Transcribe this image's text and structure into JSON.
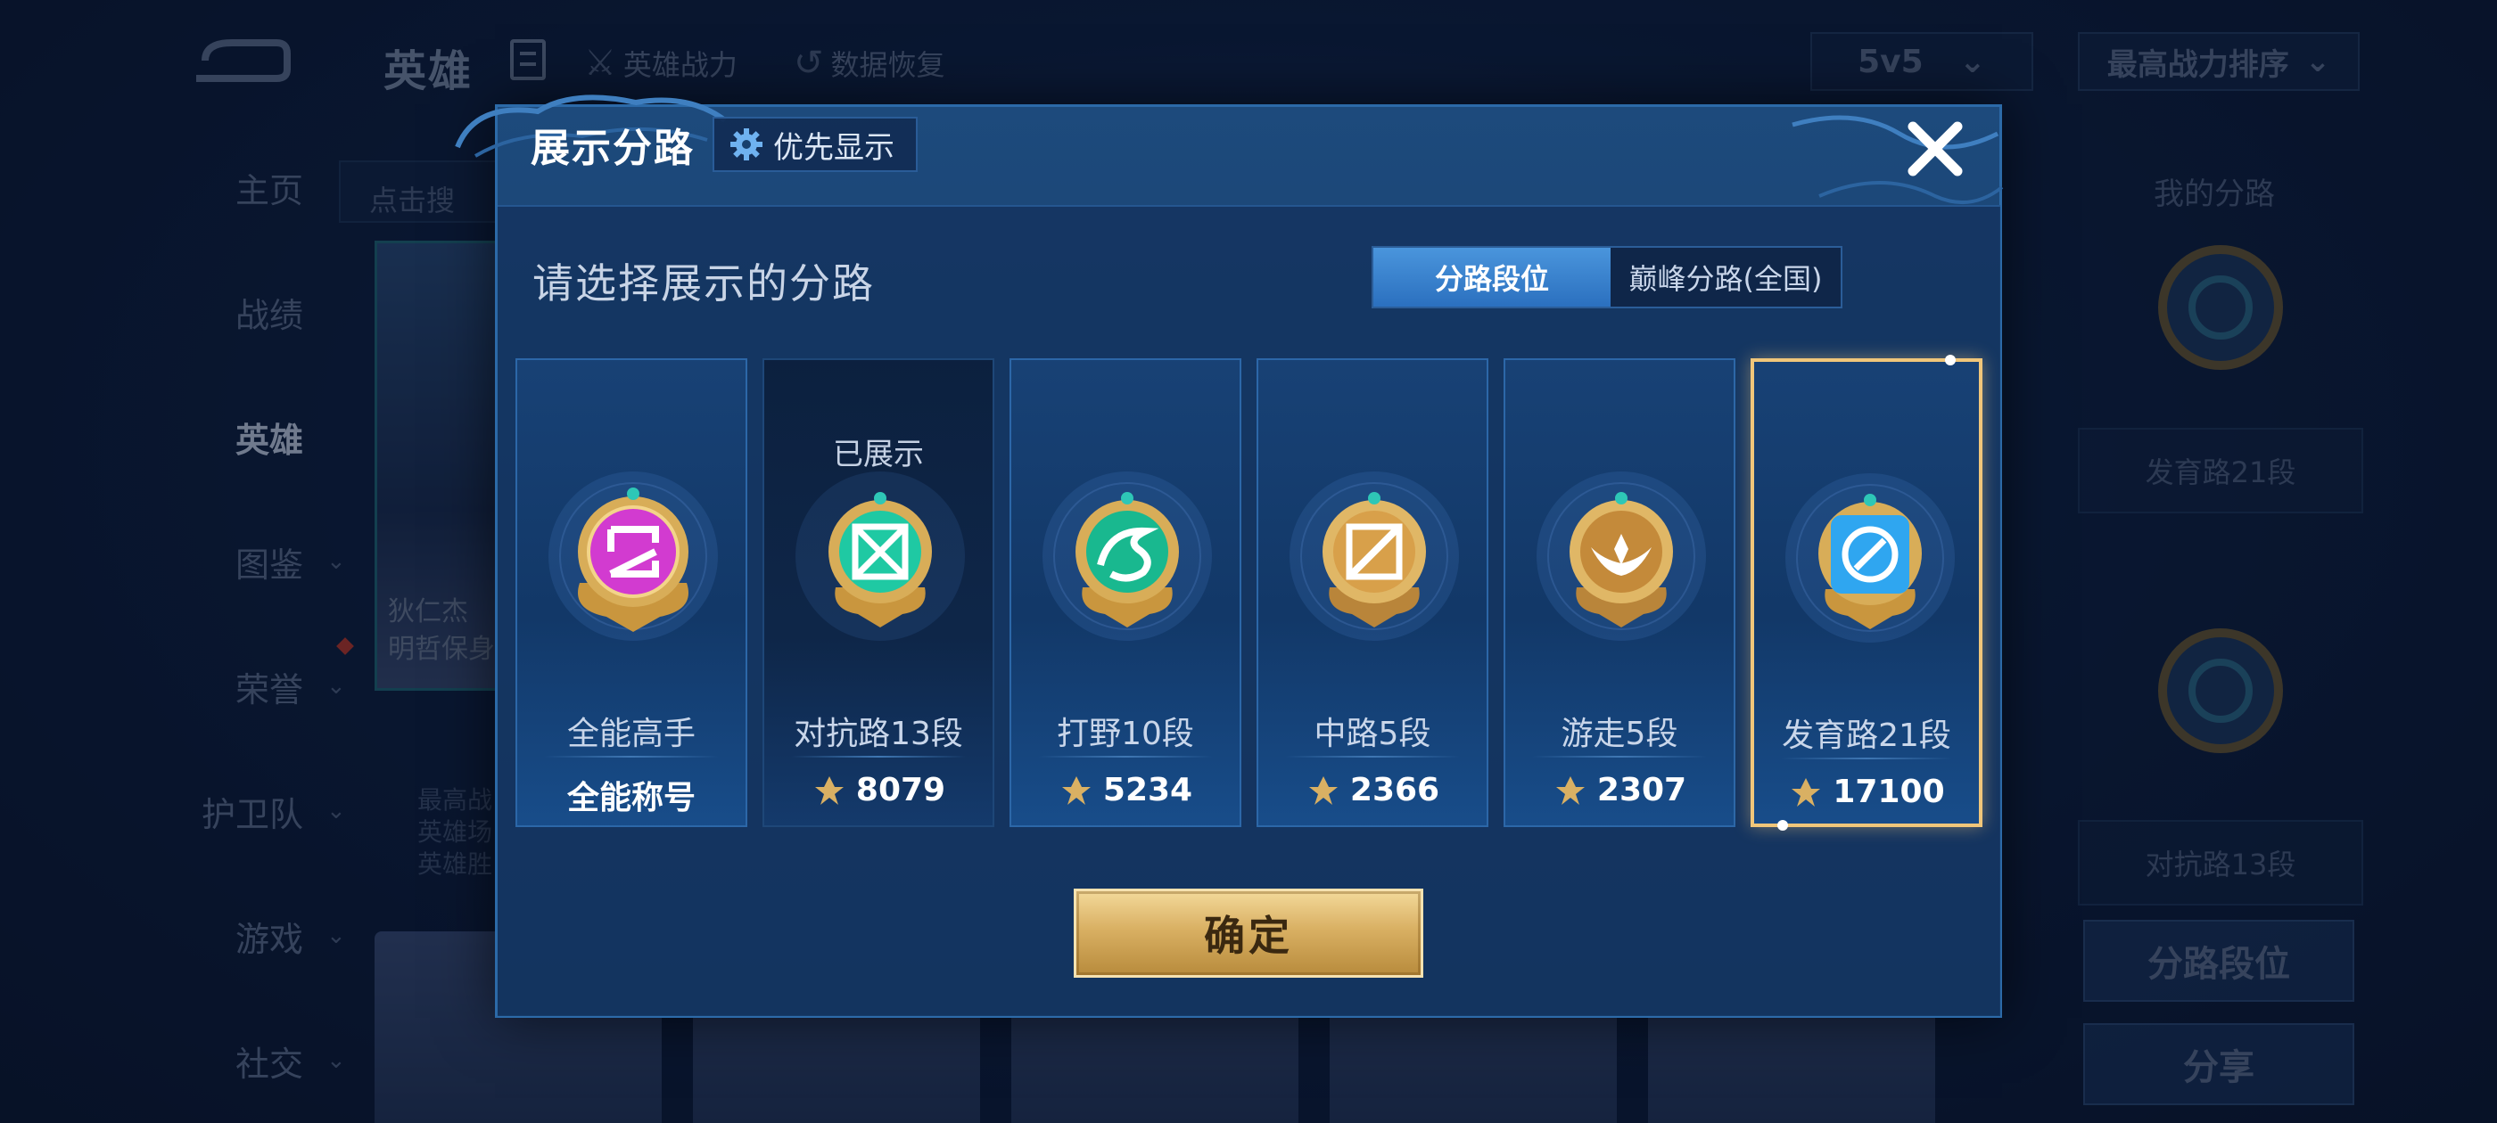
{
  "top_bar": {
    "title": "英雄",
    "links": [
      {
        "label": "英雄战力",
        "icon": "hero-power-icon"
      },
      {
        "label": "数据恢复",
        "icon": "data-restore-icon"
      }
    ],
    "mode_select": "5v5",
    "sort_select": "最高战力排序"
  },
  "sidebar": {
    "items": [
      {
        "label": "主页",
        "has_chevron": false
      },
      {
        "label": "战绩",
        "has_chevron": false
      },
      {
        "label": "英雄",
        "has_chevron": false,
        "active": true
      },
      {
        "label": "图鉴",
        "has_chevron": true
      },
      {
        "label": "荣誉",
        "has_chevron": true
      },
      {
        "label": "护卫队",
        "has_chevron": true
      },
      {
        "label": "游戏",
        "has_chevron": true
      },
      {
        "label": "社交",
        "has_chevron": true
      }
    ]
  },
  "background": {
    "search_hint": "点击搜",
    "hero_name_lines": [
      "狄仁杰",
      "明哲保身"
    ],
    "hero_info_lines": [
      "最高战",
      "英雄场",
      "英雄胜"
    ]
  },
  "right_panel": {
    "title": "我的分路",
    "card_1": "发育路21段",
    "card_2": "对抗路13段",
    "btn_lane_rank": "分路段位",
    "btn_share": "分享"
  },
  "modal": {
    "title": "展示分路",
    "priority_button": "优先显示",
    "prompt": "请选择展示的分路",
    "segmented": {
      "active": "分路段位",
      "inactive": "巅峰分路(全国)"
    },
    "confirm": "确定",
    "lanes": [
      {
        "name": "全能高手",
        "subtitle": "全能称号",
        "score": null,
        "shown_label": null,
        "color": "#d23bd0",
        "style": "normal"
      },
      {
        "name": "对抗路13段",
        "score": "8079",
        "shown_label": "已展示",
        "color": "#1fc9a3",
        "style": "dark"
      },
      {
        "name": "打野10段",
        "score": "5234",
        "shown_label": null,
        "color": "#19b88f",
        "style": "normal"
      },
      {
        "name": "中路5段",
        "score": "2366",
        "shown_label": null,
        "color": "#d8a04a",
        "style": "normal"
      },
      {
        "name": "游走5段",
        "score": "2307",
        "shown_label": null,
        "color": "#d8a04a",
        "style": "normal"
      },
      {
        "name": "发育路21段",
        "score": "17100",
        "shown_label": null,
        "color": "#2fa6f0",
        "style": "selected"
      }
    ]
  },
  "colors": {
    "accent_gold": "#f0c67a",
    "segment_blue": "#3a85d3",
    "confirm_gold": "#d9b063"
  }
}
